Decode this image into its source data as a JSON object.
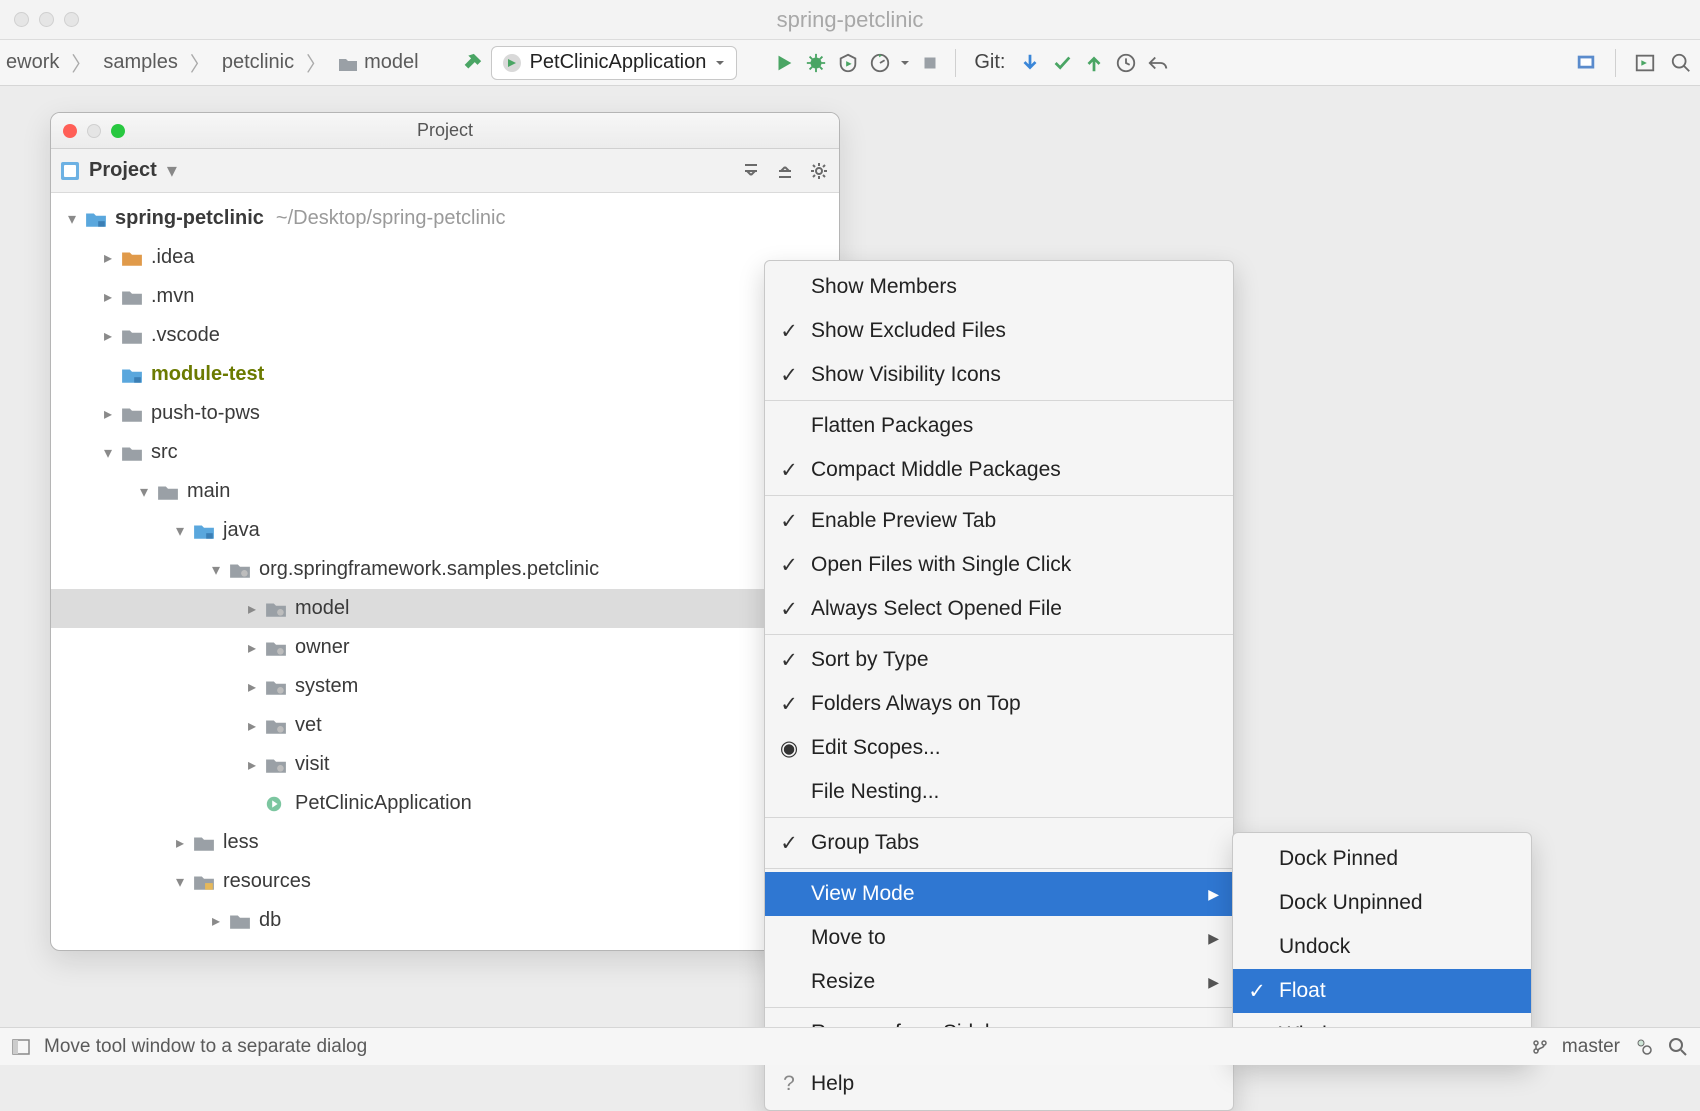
{
  "window": {
    "title": "spring-petclinic"
  },
  "breadcrumbs": [
    "ework",
    "samples",
    "petclinic",
    "model"
  ],
  "run_config": "PetClinicApplication",
  "git_label": "Git:",
  "project_panel": {
    "title": "Project",
    "dropdown_label": "Project",
    "tree": {
      "root": {
        "name": "spring-petclinic",
        "path": "~/Desktop/spring-petclinic"
      },
      "items": [
        {
          "name": ".idea",
          "kind": "folder-orange",
          "expandable": true,
          "depth": 1
        },
        {
          "name": ".mvn",
          "kind": "folder-grey",
          "expandable": true,
          "depth": 1
        },
        {
          "name": ".vscode",
          "kind": "folder-grey",
          "expandable": true,
          "depth": 1
        },
        {
          "name": "module-test",
          "kind": "folder-blue-mod",
          "expandable": false,
          "depth": 1,
          "olive": true
        },
        {
          "name": "push-to-pws",
          "kind": "folder-grey",
          "expandable": true,
          "depth": 1
        },
        {
          "name": "src",
          "kind": "folder-grey",
          "expandable": true,
          "expanded": true,
          "depth": 1
        },
        {
          "name": "main",
          "kind": "folder-grey",
          "expandable": true,
          "expanded": true,
          "depth": 2
        },
        {
          "name": "java",
          "kind": "folder-blue",
          "expandable": true,
          "expanded": true,
          "depth": 3
        },
        {
          "name": "org.springframework.samples.petclinic",
          "kind": "package",
          "expandable": true,
          "expanded": true,
          "depth": 4
        },
        {
          "name": "model",
          "kind": "package",
          "expandable": true,
          "depth": 5,
          "selected": true
        },
        {
          "name": "owner",
          "kind": "package",
          "expandable": true,
          "depth": 5
        },
        {
          "name": "system",
          "kind": "package",
          "expandable": true,
          "depth": 5
        },
        {
          "name": "vet",
          "kind": "package",
          "expandable": true,
          "depth": 5
        },
        {
          "name": "visit",
          "kind": "package",
          "expandable": true,
          "depth": 5
        },
        {
          "name": "PetClinicApplication",
          "kind": "spring-class",
          "expandable": false,
          "depth": 5
        },
        {
          "name": "less",
          "kind": "folder-grey",
          "expandable": true,
          "depth": 3
        },
        {
          "name": "resources",
          "kind": "folder-resource",
          "expandable": true,
          "expanded": true,
          "depth": 3
        },
        {
          "name": "db",
          "kind": "folder-grey",
          "expandable": true,
          "depth": 4
        }
      ]
    }
  },
  "menu_main": [
    {
      "label": "Show Members",
      "check": false
    },
    {
      "label": "Show Excluded Files",
      "check": true
    },
    {
      "label": "Show Visibility Icons",
      "check": true
    },
    {
      "sep": true
    },
    {
      "label": "Flatten Packages",
      "check": false
    },
    {
      "label": "Compact Middle Packages",
      "check": true
    },
    {
      "sep": true
    },
    {
      "label": "Enable Preview Tab",
      "check": true
    },
    {
      "label": "Open Files with Single Click",
      "check": true
    },
    {
      "label": "Always Select Opened File",
      "check": true
    },
    {
      "sep": true
    },
    {
      "label": "Sort by Type",
      "check": true
    },
    {
      "label": "Folders Always on Top",
      "check": true
    },
    {
      "label": "Edit Scopes...",
      "icon": "target"
    },
    {
      "label": "File Nesting..."
    },
    {
      "sep": true
    },
    {
      "label": "Group Tabs",
      "check": true
    },
    {
      "sep": true
    },
    {
      "label": "View Mode",
      "submenu": true,
      "highlight": true
    },
    {
      "label": "Move to",
      "submenu": true
    },
    {
      "label": "Resize",
      "submenu": true
    },
    {
      "sep": true
    },
    {
      "label": "Remove from Sidebar"
    },
    {
      "sep": true
    },
    {
      "label": "Help",
      "icon": "help"
    }
  ],
  "menu_viewmode": [
    {
      "label": "Dock Pinned"
    },
    {
      "label": "Dock Unpinned"
    },
    {
      "label": "Undock"
    },
    {
      "label": "Float",
      "check": true,
      "highlight": true
    },
    {
      "label": "Window"
    }
  ],
  "status_bar": {
    "hint": "Move tool window to a separate dialog",
    "branch": "master"
  }
}
